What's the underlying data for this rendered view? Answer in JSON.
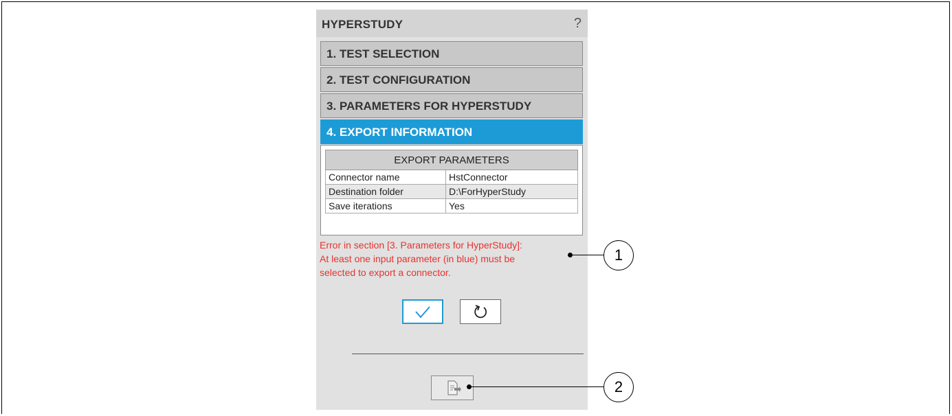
{
  "panel": {
    "title": "HYPERSTUDY",
    "help": "?"
  },
  "sections": [
    {
      "label": "1. TEST SELECTION",
      "active": false
    },
    {
      "label": "2. TEST CONFIGURATION",
      "active": false
    },
    {
      "label": "3. PARAMETERS FOR HYPERSTUDY",
      "active": false
    },
    {
      "label": "4. EXPORT INFORMATION",
      "active": true
    }
  ],
  "export_table": {
    "header": "EXPORT PARAMETERS",
    "rows": [
      {
        "key": "Connector name",
        "value": "HstConnector"
      },
      {
        "key": "Destination folder",
        "value": "D:\\ForHyperStudy"
      },
      {
        "key": "Save iterations",
        "value": "Yes"
      }
    ]
  },
  "error": {
    "line1": "Error in section [3. Parameters for HyperStudy]:",
    "line2": "At least one input parameter (in blue) must be",
    "line3": "selected to export a connector."
  },
  "icons": {
    "confirm": "check-icon",
    "reset": "reset-icon",
    "export": "export-file-icon"
  },
  "callouts": [
    "1",
    "2"
  ],
  "colors": {
    "accent": "#1d9bd7",
    "error": "#e8322e",
    "panel_bg": "#e1e1e1"
  }
}
